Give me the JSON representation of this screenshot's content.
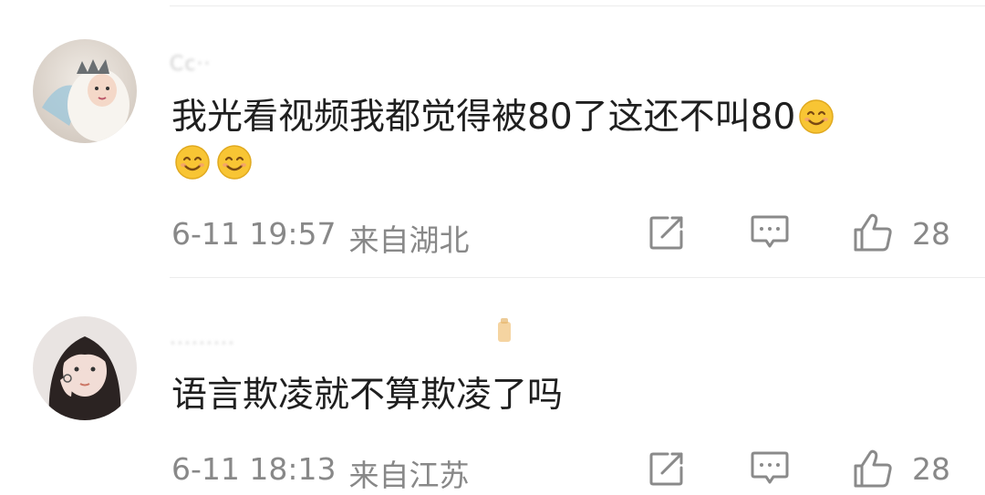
{
  "comments": [
    {
      "username": "Cc··",
      "text": "我光看视频我都觉得被80了这还不叫80",
      "emojis_after": 3,
      "time": "6-11 19:57",
      "location": "来自湖北",
      "likes": "28"
    },
    {
      "username": "·········",
      "text": "语言欺凌就不算欺凌了吗",
      "emojis_after": 0,
      "time": "6-11 18:13",
      "location": "来自江苏",
      "likes": "28"
    }
  ],
  "icons": {
    "share": "share-icon",
    "reply": "comment-icon",
    "like": "thumbs-up-icon",
    "emoji": "smile-emoji-icon"
  },
  "colors": {
    "meta": "#888888",
    "text": "#1f1f1f",
    "emoji": "#f8c534"
  }
}
